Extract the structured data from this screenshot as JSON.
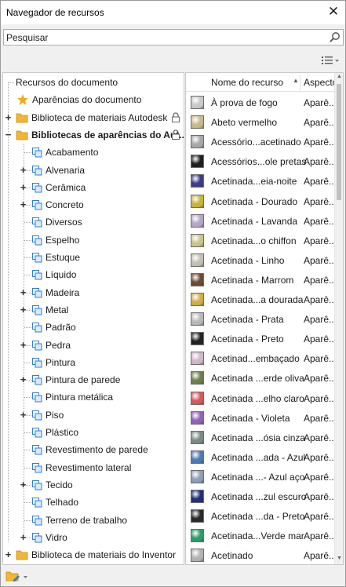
{
  "window": {
    "title": "Navegador de recursos",
    "close_glyph": "✕"
  },
  "search": {
    "placeholder": "Pesquisar",
    "value": ""
  },
  "toolbar": {
    "view_menu_icon": "list-view-icon"
  },
  "tree": {
    "items": [
      {
        "label": "Recursos do documento",
        "icon": "none",
        "level": 0,
        "expander": "",
        "locked": false,
        "bold": false
      },
      {
        "label": "Aparências do documento",
        "icon": "star-icon",
        "level": 1,
        "expander": "",
        "locked": false,
        "bold": false
      },
      {
        "label": "Biblioteca de materiais Autodesk",
        "icon": "folder-icon",
        "level": 0,
        "expander": "+",
        "locked": true,
        "bold": false
      },
      {
        "label": "Bibliotecas de aparências do Aut...",
        "icon": "folder-icon",
        "level": 0,
        "expander": "−",
        "locked": true,
        "bold": true
      },
      {
        "label": "Acabamento",
        "icon": "category-icon",
        "level": 2,
        "expander": "",
        "locked": false,
        "bold": false
      },
      {
        "label": "Alvenaria",
        "icon": "category-icon",
        "level": 2,
        "expander": "+",
        "locked": false,
        "bold": false
      },
      {
        "label": "Cerâmica",
        "icon": "category-icon",
        "level": 2,
        "expander": "+",
        "locked": false,
        "bold": false
      },
      {
        "label": "Concreto",
        "icon": "category-icon",
        "level": 2,
        "expander": "+",
        "locked": false,
        "bold": false
      },
      {
        "label": "Diversos",
        "icon": "category-icon",
        "level": 2,
        "expander": "",
        "locked": false,
        "bold": false
      },
      {
        "label": "Espelho",
        "icon": "category-icon",
        "level": 2,
        "expander": "",
        "locked": false,
        "bold": false
      },
      {
        "label": "Estuque",
        "icon": "category-icon",
        "level": 2,
        "expander": "",
        "locked": false,
        "bold": false
      },
      {
        "label": "Líquido",
        "icon": "category-icon",
        "level": 2,
        "expander": "",
        "locked": false,
        "bold": false
      },
      {
        "label": "Madeira",
        "icon": "category-icon",
        "level": 2,
        "expander": "+",
        "locked": false,
        "bold": false
      },
      {
        "label": "Metal",
        "icon": "category-icon",
        "level": 2,
        "expander": "+",
        "locked": false,
        "bold": false
      },
      {
        "label": "Padrão",
        "icon": "category-icon",
        "level": 2,
        "expander": "",
        "locked": false,
        "bold": false
      },
      {
        "label": "Pedra",
        "icon": "category-icon",
        "level": 2,
        "expander": "+",
        "locked": false,
        "bold": false
      },
      {
        "label": "Pintura",
        "icon": "category-icon",
        "level": 2,
        "expander": "",
        "locked": false,
        "bold": false
      },
      {
        "label": "Pintura de parede",
        "icon": "category-icon",
        "level": 2,
        "expander": "+",
        "locked": false,
        "bold": false
      },
      {
        "label": "Pintura metálica",
        "icon": "category-icon",
        "level": 2,
        "expander": "",
        "locked": false,
        "bold": false
      },
      {
        "label": "Piso",
        "icon": "category-icon",
        "level": 2,
        "expander": "+",
        "locked": false,
        "bold": false
      },
      {
        "label": "Plástico",
        "icon": "category-icon",
        "level": 2,
        "expander": "",
        "locked": false,
        "bold": false
      },
      {
        "label": "Revestimento de parede",
        "icon": "category-icon",
        "level": 2,
        "expander": "",
        "locked": false,
        "bold": false
      },
      {
        "label": "Revestimento lateral",
        "icon": "category-icon",
        "level": 2,
        "expander": "",
        "locked": false,
        "bold": false
      },
      {
        "label": "Tecido",
        "icon": "category-icon",
        "level": 2,
        "expander": "+",
        "locked": false,
        "bold": false
      },
      {
        "label": "Telhado",
        "icon": "category-icon",
        "level": 2,
        "expander": "",
        "locked": false,
        "bold": false
      },
      {
        "label": "Terreno de trabalho",
        "icon": "category-icon",
        "level": 2,
        "expander": "",
        "locked": false,
        "bold": false
      },
      {
        "label": "Vidro",
        "icon": "category-icon",
        "level": 2,
        "expander": "+",
        "locked": false,
        "bold": false
      },
      {
        "label": "Biblioteca de materiais do Inventor",
        "icon": "folder-icon",
        "level": 0,
        "expander": "+",
        "locked": false,
        "bold": false
      }
    ]
  },
  "list": {
    "columns": {
      "name": "Nome do recurso",
      "aspect": "Aspecto"
    },
    "sort_glyph": "▲",
    "rows": [
      {
        "name": "À prova de fogo",
        "aspect": "Aparê...",
        "color": "#c9c9c9"
      },
      {
        "name": "Abeto vermelho",
        "aspect": "Aparê...",
        "color": "#c8b98c"
      },
      {
        "name": "Acessório...acetinado",
        "aspect": "Aparê...",
        "color": "#a7a7a7"
      },
      {
        "name": "Acessórios...ole pretas",
        "aspect": "Aparê...",
        "color": "#1e1e1e"
      },
      {
        "name": "Acetinada...eia-noite",
        "aspect": "Aparê...",
        "color": "#3a3a8a"
      },
      {
        "name": "Acetinada - Dourado",
        "aspect": "Aparê...",
        "color": "#c7b53b"
      },
      {
        "name": "Acetinada - Lavanda",
        "aspect": "Aparê...",
        "color": "#b5a6c7"
      },
      {
        "name": "Acetinada...o chiffon",
        "aspect": "Aparê...",
        "color": "#c9c48a"
      },
      {
        "name": "Acetinada - Linho",
        "aspect": "Aparê...",
        "color": "#c3bfb4"
      },
      {
        "name": "Acetinada - Marrom",
        "aspect": "Aparê...",
        "color": "#6b4a32"
      },
      {
        "name": "Acetinada...a dourada",
        "aspect": "Aparê...",
        "color": "#d1ac4a"
      },
      {
        "name": "Acetinada - Prata",
        "aspect": "Aparê...",
        "color": "#b8b8b8"
      },
      {
        "name": "Acetinada - Preto",
        "aspect": "Aparê...",
        "color": "#232323"
      },
      {
        "name": "Acetinad...embaçado",
        "aspect": "Aparê...",
        "color": "#d0b7c8"
      },
      {
        "name": "Acetinada ...erde oliva",
        "aspect": "Aparê...",
        "color": "#6f7e4e"
      },
      {
        "name": "Acetinada ...elho claro",
        "aspect": "Aparê...",
        "color": "#d65858"
      },
      {
        "name": "Acetinada - Violeta",
        "aspect": "Aparê...",
        "color": "#8e63b5"
      },
      {
        "name": "Acetinada ...ósia cinza",
        "aspect": "Aparê...",
        "color": "#7e8a86"
      },
      {
        "name": "Acetinada ...ada - Azul",
        "aspect": "Aparê...",
        "color": "#4e79b5"
      },
      {
        "name": "Acetinada ...- Azul aço",
        "aspect": "Aparê...",
        "color": "#8c9fb5"
      },
      {
        "name": "Acetinada ...zul escuro",
        "aspect": "Aparê...",
        "color": "#1f2f7a"
      },
      {
        "name": "Acetinada ...da - Preto",
        "aspect": "Aparê...",
        "color": "#2a2a2a"
      },
      {
        "name": "Acetinada...Verde mar",
        "aspect": "Aparê...",
        "color": "#2f9b6a"
      },
      {
        "name": "Acetinado",
        "aspect": "Aparê...",
        "color": "#b3b3b3"
      }
    ]
  },
  "scrollbar": {
    "up_glyph": "▲",
    "down_glyph": "▼"
  },
  "colors": {
    "folder": "#f2b632",
    "star": "#f2a81f",
    "category_icon": "#2d7fd6"
  }
}
